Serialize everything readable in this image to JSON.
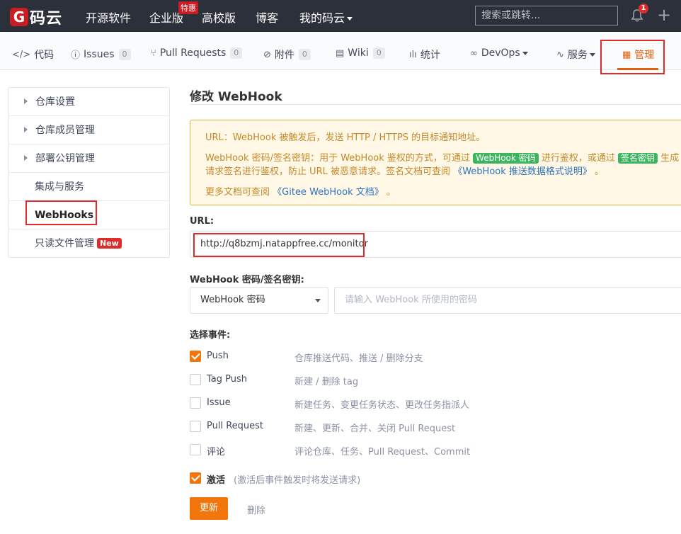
{
  "topnav": {
    "logo_mark": "G",
    "logo_text": "码云",
    "items": [
      "开源软件",
      "企业版",
      "高校版",
      "博客",
      "我的码云"
    ],
    "badge": "特惠",
    "search_placeholder": "搜索或跳转...",
    "notification_count": "1",
    "plus_label": "+"
  },
  "repo_tabs": [
    {
      "icon": "</>",
      "label": "代码",
      "count": ""
    },
    {
      "icon": "ⓘ",
      "label": "Issues",
      "count": "0"
    },
    {
      "icon": "⑂",
      "label": "Pull Requests",
      "count": "0"
    },
    {
      "icon": "⊘",
      "label": "附件",
      "count": "0"
    },
    {
      "icon": "▤",
      "label": "Wiki",
      "count": "0"
    },
    {
      "icon": "ılı",
      "label": "统计",
      "count": ""
    },
    {
      "icon": "∞",
      "label": "DevOps",
      "count": ""
    },
    {
      "icon": "∿",
      "label": "服务",
      "count": ""
    },
    {
      "icon": "▦",
      "label": "管理",
      "count": ""
    }
  ],
  "sidebar": {
    "items": [
      {
        "label": "仓库设置"
      },
      {
        "label": "仓库成员管理"
      },
      {
        "label": "部署公钥管理"
      },
      {
        "label": "集成与服务"
      },
      {
        "label": "WebHooks"
      },
      {
        "label": "只读文件管理",
        "badge": "New"
      }
    ]
  },
  "main": {
    "title": "修改 WebHook",
    "notice": {
      "line1": "URL：WebHook 被触发后，发送 HTTP / HTTPS 的目标通知地址。",
      "line2a": "WebHook 密码/签名密钥：用于 WebHook 鉴权的方式，可通过",
      "line2_tag1": "WebHook 密码",
      "line2b": "进行鉴权，或通过",
      "line2_tag2": "签名密钥",
      "line2c": "生成",
      "line3a": "请求签名进行鉴权，防止 URL 被恶意请求。签名文档可查阅",
      "line3_link": "《WebHook 推送数据格式说明》",
      "line3b": "。",
      "line4a": "更多文档可查阅",
      "line4_link": "《Gitee WebHook 文档》",
      "line4b": "。"
    },
    "url_label": "URL:",
    "url_value": "http://q8bzmj.natappfree.cc/monitor",
    "secret_label": "WebHook 密码/签名密钥:",
    "secret_type": "WebHook 密码",
    "secret_placeholder": "请输入 WebHook 所使用的密码",
    "events_label": "选择事件:",
    "events": [
      {
        "name": "Push",
        "desc": "仓库推送代码、推送 / 删除分支",
        "checked": true
      },
      {
        "name": "Tag Push",
        "desc": "新建 / 删除 tag",
        "checked": false
      },
      {
        "name": "Issue",
        "desc": "新建任务、变更任务状态、更改任务指派人",
        "checked": false
      },
      {
        "name": "Pull Request",
        "desc": "新建、更新、合并、关闭 Pull Request",
        "checked": false
      },
      {
        "name": "评论",
        "desc": "评论仓库、任务、Pull Request、Commit",
        "checked": false
      }
    ],
    "active": {
      "name": "激活",
      "desc": "(激活后事件触发时将发送请求)",
      "checked": true
    },
    "update_button": "更新",
    "delete_button": "删除"
  }
}
